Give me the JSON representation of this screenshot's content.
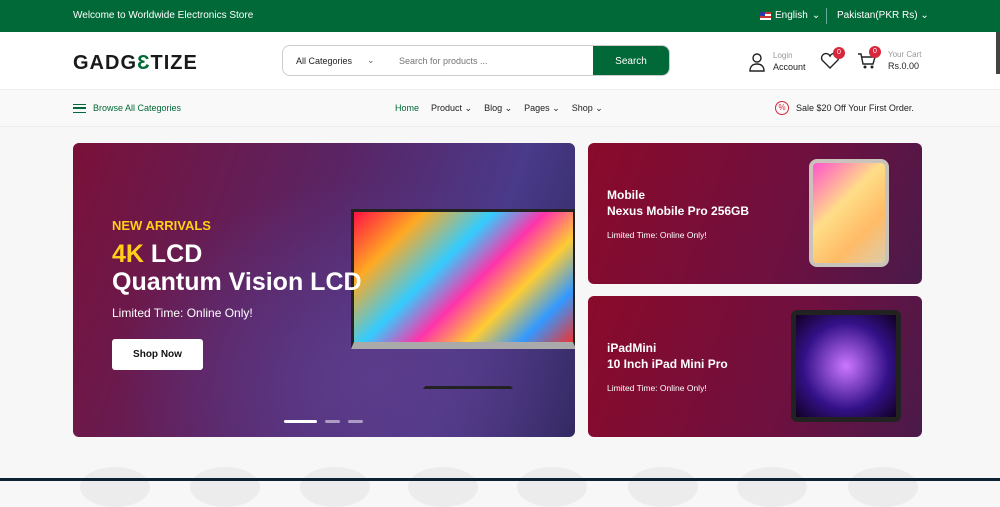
{
  "topbar": {
    "welcome": "Welcome to Worldwide Electronics Store",
    "language": "English",
    "currency": "Pakistan(PKR Rs)"
  },
  "header": {
    "logo": "GADGETIZE",
    "search": {
      "category": "All Categories",
      "placeholder": "Search for products ...",
      "button": "Search"
    },
    "account": {
      "line1": "Login",
      "line2": "Account"
    },
    "wishlist_count": "0",
    "cart_count": "0",
    "cart": {
      "line1": "Your Cart",
      "total": "Rs.0.00"
    }
  },
  "nav": {
    "browse": "Browse All Categories",
    "items": [
      "Home",
      "Product",
      "Blog",
      "Pages",
      "Shop"
    ],
    "sale": "Sale $20 Off Your First Order."
  },
  "hero": {
    "tag": "NEW ARRIVALS",
    "title_highlight": "4K",
    "title_rest": " LCD",
    "title_line2": "Quantum Vision LCD",
    "subtitle": "Limited Time: Online Only!",
    "button": "Shop Now",
    "active_slide": 1,
    "slides": 3
  },
  "cards": [
    {
      "line1": "Mobile",
      "line2": "Nexus Mobile Pro 256GB",
      "subtitle": "Limited Time: Online Only!"
    },
    {
      "line1": "iPadMini",
      "line2": "10 Inch iPad Mini Pro",
      "subtitle": "Limited Time: Online Only!"
    }
  ],
  "colors": {
    "brand": "#006937",
    "badge": "#d8263b",
    "accent": "#ffcf1a"
  }
}
